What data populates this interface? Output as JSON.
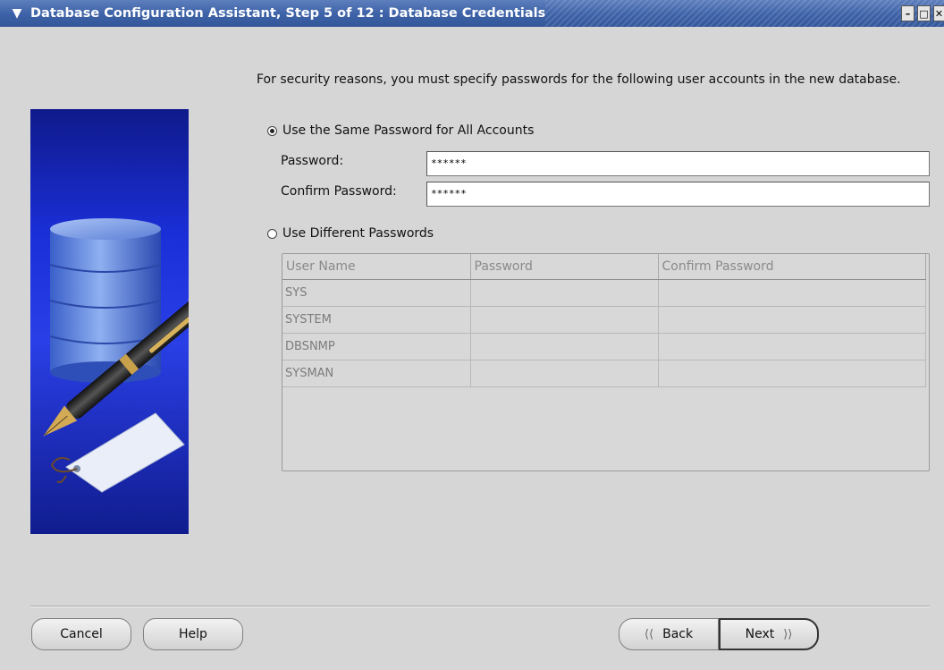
{
  "window": {
    "title": "Database Configuration Assistant, Step 5 of 12 : Database Credentials",
    "menu_icon": "chevron-down-icon",
    "controls": [
      "minimize-icon",
      "maximize-icon",
      "close-icon"
    ]
  },
  "intro_text": "For security reasons, you must specify passwords for the following user accounts in the new database.",
  "same_password": {
    "label": "Use the Same Password for All Accounts",
    "selected": true,
    "password_label": "Password:",
    "password_value": "******",
    "confirm_label": "Confirm Password:",
    "confirm_value": "******"
  },
  "different_passwords": {
    "label": "Use Different Passwords",
    "selected": false,
    "columns": [
      "User Name",
      "Password",
      "Confirm Password"
    ],
    "rows": [
      {
        "user": "SYS",
        "password": "",
        "confirm": ""
      },
      {
        "user": "SYSTEM",
        "password": "",
        "confirm": ""
      },
      {
        "user": "DBSNMP",
        "password": "",
        "confirm": ""
      },
      {
        "user": "SYSMAN",
        "password": "",
        "confirm": ""
      }
    ]
  },
  "buttons": {
    "cancel": "Cancel",
    "help": "Help",
    "back_mnemonic": "B",
    "back_rest": "ack",
    "next_mnemonic": "N",
    "next_rest": "ext"
  },
  "colors": {
    "titlebar": "#3f63a8",
    "graphic_blue": "#1b2fd9",
    "dialog_bg": "#d6d6d6"
  }
}
